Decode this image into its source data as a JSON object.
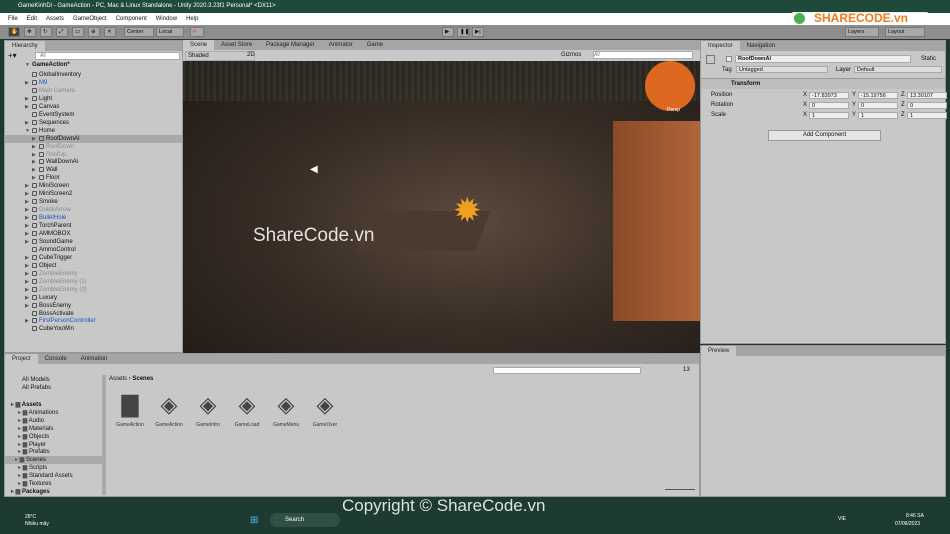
{
  "window": {
    "title": "GameKinhDi - GameAction - PC, Mac & Linux Standalone - Unity 2020.3.23f1 Personal* <DX11>"
  },
  "menu": [
    "File",
    "Edit",
    "Assets",
    "GameObject",
    "Component",
    "Window",
    "Help"
  ],
  "toolbar": {
    "center": "Center",
    "local": "Local",
    "layers": "Layers",
    "layout": "Layout"
  },
  "hierarchy": {
    "tab": "Hierarchy",
    "search_placeholder": "All",
    "scene": "GameAction*",
    "items": [
      {
        "label": "GlobalInventory",
        "depth": 1,
        "arrow": false,
        "style": ""
      },
      {
        "label": "M9",
        "depth": 1,
        "arrow": true,
        "style": "blue"
      },
      {
        "label": "Main Camera",
        "depth": 1,
        "arrow": false,
        "style": "dim"
      },
      {
        "label": "Light",
        "depth": 1,
        "arrow": true,
        "style": ""
      },
      {
        "label": "Canvas",
        "depth": 1,
        "arrow": true,
        "style": ""
      },
      {
        "label": "EventSystem",
        "depth": 1,
        "arrow": false,
        "style": ""
      },
      {
        "label": "Sequences",
        "depth": 1,
        "arrow": true,
        "style": ""
      },
      {
        "label": "Home",
        "depth": 1,
        "arrow": true,
        "style": "open"
      },
      {
        "label": "RoofDownAI",
        "depth": 2,
        "arrow": true,
        "style": "sel"
      },
      {
        "label": "RoofDown",
        "depth": 2,
        "arrow": true,
        "style": "dim"
      },
      {
        "label": "RoofUp",
        "depth": 2,
        "arrow": true,
        "style": "dim"
      },
      {
        "label": "WallDownAi",
        "depth": 2,
        "arrow": true,
        "style": ""
      },
      {
        "label": "Wall",
        "depth": 2,
        "arrow": true,
        "style": ""
      },
      {
        "label": "Floor",
        "depth": 2,
        "arrow": true,
        "style": ""
      },
      {
        "label": "MiniScreen",
        "depth": 1,
        "arrow": true,
        "style": ""
      },
      {
        "label": "MiniScreen2",
        "depth": 1,
        "arrow": true,
        "style": ""
      },
      {
        "label": "Smoke",
        "depth": 1,
        "arrow": true,
        "style": ""
      },
      {
        "label": "GuideArrow",
        "depth": 1,
        "arrow": true,
        "style": "dim"
      },
      {
        "label": "BulletHole",
        "depth": 1,
        "arrow": true,
        "style": "blue"
      },
      {
        "label": "TorchParent",
        "depth": 1,
        "arrow": true,
        "style": ""
      },
      {
        "label": "AMMOBOX",
        "depth": 1,
        "arrow": true,
        "style": ""
      },
      {
        "label": "SoundGame",
        "depth": 1,
        "arrow": true,
        "style": ""
      },
      {
        "label": "AmmoControl",
        "depth": 1,
        "arrow": false,
        "style": ""
      },
      {
        "label": "CubeTrigger",
        "depth": 1,
        "arrow": true,
        "style": ""
      },
      {
        "label": "Object",
        "depth": 1,
        "arrow": true,
        "style": ""
      },
      {
        "label": "ZombieEnemy",
        "depth": 1,
        "arrow": true,
        "style": "dim"
      },
      {
        "label": "ZombieEnemy (1)",
        "depth": 1,
        "arrow": true,
        "style": "dim"
      },
      {
        "label": "ZombieEnemy (2)",
        "depth": 1,
        "arrow": true,
        "style": "dim"
      },
      {
        "label": "Luxury",
        "depth": 1,
        "arrow": true,
        "style": ""
      },
      {
        "label": "BossEnemy",
        "depth": 1,
        "arrow": true,
        "style": ""
      },
      {
        "label": "BossActivate",
        "depth": 1,
        "arrow": false,
        "style": ""
      },
      {
        "label": "FirstPersonController",
        "depth": 1,
        "arrow": true,
        "style": "blue"
      },
      {
        "label": "CubeYouWin",
        "depth": 1,
        "arrow": false,
        "style": ""
      }
    ]
  },
  "scene_tabs": [
    "Scene",
    "Asset Store",
    "Package Manager",
    "Animator",
    "Game"
  ],
  "scene": {
    "shading": "Shaded",
    "mode_2d": "2D",
    "gizmos": "Gizmos",
    "search_placeholder": "All",
    "persp": "Persp",
    "watermark": "ShareCode.vn"
  },
  "inspector": {
    "tabs": [
      "Inspector",
      "Navigation"
    ],
    "object_name": "RoofDownAI",
    "static_label": "Static",
    "tag_label": "Tag",
    "tag": "Untagged",
    "layer_label": "Layer",
    "layer": "Default",
    "component": "Transform",
    "rows": [
      {
        "label": "Position",
        "x": "-17.83973",
        "y": "-15.19756",
        "z": "13.30107"
      },
      {
        "label": "Rotation",
        "x": "0",
        "y": "0",
        "z": "0"
      },
      {
        "label": "Scale",
        "x": "1",
        "y": "1",
        "z": "1"
      }
    ],
    "add_component": "Add Component"
  },
  "preview": {
    "tab": "Preview"
  },
  "project": {
    "tabs": [
      "Project",
      "Console",
      "Animation"
    ],
    "hidden_count": "13",
    "favorites": [
      "All Models",
      "All Prefabs"
    ],
    "tree": [
      {
        "label": "Assets",
        "depth": 0,
        "bold": true
      },
      {
        "label": "Animations",
        "depth": 1
      },
      {
        "label": "Audio",
        "depth": 1
      },
      {
        "label": "Materials",
        "depth": 1
      },
      {
        "label": "Objects",
        "depth": 1
      },
      {
        "label": "Player",
        "depth": 1
      },
      {
        "label": "Prefabs",
        "depth": 1
      },
      {
        "label": "Scenes",
        "depth": 1,
        "sel": true
      },
      {
        "label": "Scripts",
        "depth": 1
      },
      {
        "label": "Standard Assets",
        "depth": 1
      },
      {
        "label": "Textures",
        "depth": 1
      },
      {
        "label": "Packages",
        "depth": 0,
        "bold": true
      }
    ],
    "breadcrumb": [
      "Assets",
      "Scenes"
    ],
    "assets": [
      {
        "label": "GameAction",
        "type": "folder"
      },
      {
        "label": "GameAction",
        "type": "unity"
      },
      {
        "label": "GameIntro",
        "type": "unity"
      },
      {
        "label": "GameLoad",
        "type": "unity"
      },
      {
        "label": "GameMenu",
        "type": "unity"
      },
      {
        "label": "GameOver",
        "type": "unity"
      }
    ]
  },
  "taskbar": {
    "weather_temp": "28°C",
    "weather_desc": "Nhiều mây",
    "search": "Search",
    "lang": "VIE",
    "time": "8:46 SA",
    "date": "07/06/2023"
  },
  "watermarks": {
    "logo": "SHARECODE.vn",
    "copyright": "Copyright © ShareCode.vn"
  }
}
